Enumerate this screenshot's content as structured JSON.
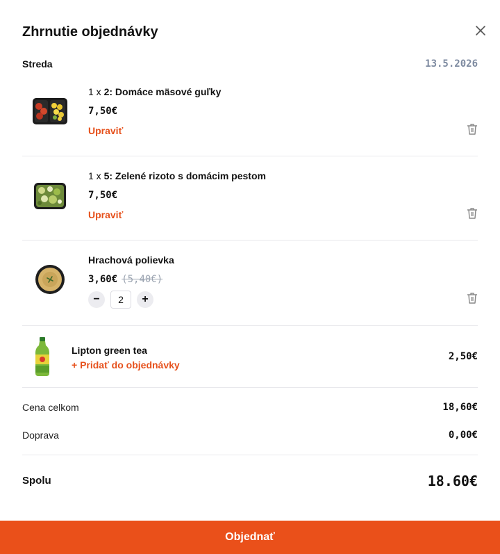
{
  "modal": {
    "title": "Zhrnutie objednávky",
    "close_icon": "close-icon"
  },
  "day": {
    "label": "Streda",
    "date": "13.5.2026"
  },
  "items": [
    {
      "qty_prefix": "1 x ",
      "name": "2: Domáce mäsové guľky",
      "price": "7,50€",
      "edit_label": "Upraviť",
      "image_icon": "meal-box-meatballs-image"
    },
    {
      "qty_prefix": "1 x ",
      "name": "5: Zelené rizoto s domácim pestom",
      "price": "7,50€",
      "edit_label": "Upraviť",
      "image_icon": "meal-box-risotto-image"
    },
    {
      "name": "Hrachová polievka",
      "price": "3,60€",
      "old_price": "(5,40€)",
      "quantity": "2",
      "minus_label": "−",
      "plus_label": "+",
      "image_icon": "soup-bowl-image"
    }
  ],
  "upsell": {
    "name": "Lipton green tea",
    "add_label": "+ Pridať do objednávky",
    "price": "2,50€",
    "image_icon": "bottle-image"
  },
  "summary": {
    "subtotal_label": "Cena celkom",
    "subtotal_value": "18,60€",
    "delivery_label": "Doprava",
    "delivery_value": "0,00€",
    "total_label": "Spolu",
    "total_value": "18.60€"
  },
  "order_button": "Objednať",
  "colors": {
    "accent": "#ea501a",
    "muted": "#7d8aa0",
    "divider": "#e8e8ec"
  }
}
